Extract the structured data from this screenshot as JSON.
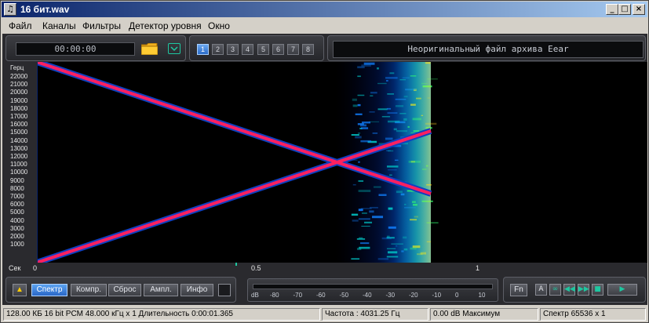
{
  "window": {
    "title": "16 бит.wav"
  },
  "menu": {
    "items": [
      "Файл",
      "Каналы",
      "Фильтры",
      "Детектор уровня",
      "Окно"
    ]
  },
  "top": {
    "timer": "00:00:00",
    "channels": [
      "1",
      "2",
      "3",
      "4",
      "5",
      "6",
      "7",
      "8"
    ],
    "active_channel": "1",
    "message": "Неоригинальный файл архива Eear"
  },
  "spectrogram": {
    "freq_unit": "Герц",
    "freq_ticks": [
      "22000",
      "21000",
      "20000",
      "19000",
      "18000",
      "17000",
      "16000",
      "15000",
      "14000",
      "13000",
      "12000",
      "11000",
      "10000",
      "9000",
      "8000",
      "7000",
      "6000",
      "5000",
      "4000",
      "3000",
      "2000",
      "1000"
    ],
    "time_unit": "Сек",
    "time_ticks": [
      "0",
      "0.5",
      "1"
    ],
    "sweep_color": "#ff2060"
  },
  "controls": {
    "buttons": [
      "Спектр",
      "Компр.",
      "Сброс",
      "Ампл.",
      "Инфо"
    ],
    "active": "Спектр",
    "meter": {
      "unit": "dB",
      "ticks": [
        "-80",
        "-70",
        "-60",
        "-50",
        "-40",
        "-30",
        "-20",
        "-10",
        "0",
        "10"
      ]
    },
    "fn": "Fn",
    "a": "A"
  },
  "status": {
    "format": "128.00 КБ 16 bit PCM 48.000 кГц x 1  Длительность 0:00:01.365",
    "frequency": "Частота : 4031.25 Гц",
    "max": "0.00 dB Максимум",
    "spectrum": "Спектр 65536 x 1"
  }
}
